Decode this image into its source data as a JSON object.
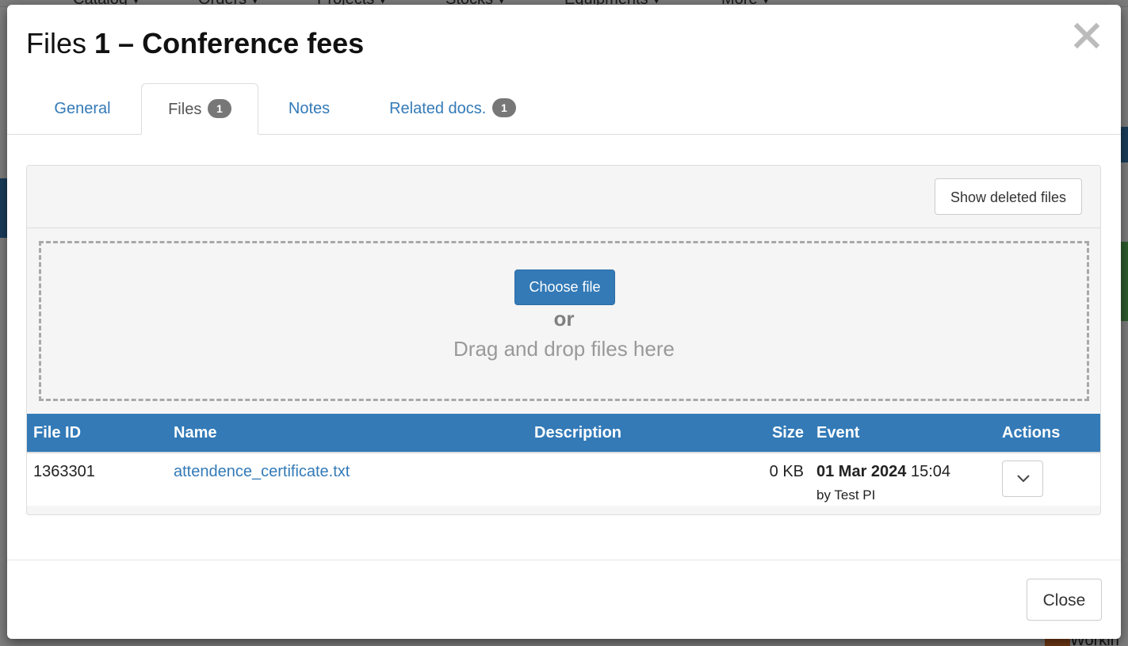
{
  "background": {
    "nav_items": [
      "Catalog ▾",
      "Orders ▾",
      "Projects ▾",
      "Stocks ▾",
      "Equipments ▾",
      "More ▾"
    ],
    "bottom_right_text": "Workin"
  },
  "modal": {
    "title_prefix": "Files",
    "title_main": "1 – Conference fees",
    "close_icon": "close-icon",
    "tabs": [
      {
        "label": "General",
        "badge": "",
        "active": false
      },
      {
        "label": "Files",
        "badge": "1",
        "active": true
      },
      {
        "label": "Notes",
        "badge": "",
        "active": false
      },
      {
        "label": "Related docs.",
        "badge": "1",
        "active": false
      }
    ],
    "toolbar": {
      "show_deleted_label": "Show deleted files"
    },
    "dropzone": {
      "choose_file_label": "Choose file",
      "or_label": "or",
      "drag_label": "Drag and drop files here"
    },
    "table": {
      "columns": [
        "File ID",
        "Name",
        "Description",
        "Size",
        "Event",
        "Actions"
      ],
      "rows": [
        {
          "file_id": "1363301",
          "name": "attendence_certificate.txt",
          "description": "",
          "size": "0 KB",
          "event_date": "01 Mar 2024",
          "event_time": "15:04",
          "event_by": "by Test PI",
          "actions_icon": "chevron-down-icon"
        }
      ]
    },
    "footer": {
      "close_label": "Close"
    }
  },
  "colors": {
    "accent": "#337ab7",
    "badge": "#777777",
    "panel_bg": "#f5f5f5"
  }
}
